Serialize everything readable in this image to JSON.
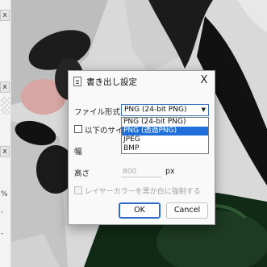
{
  "left_strip": {
    "close_glyph": "x",
    "percent_mark": "%",
    "minus_mark": "-"
  },
  "dialog": {
    "title": "書き出し設定",
    "close_glyph": "X",
    "format_label": "ファイル形式",
    "format_selected": "PNG (24-bit PNG)",
    "format_options": [
      {
        "label": "PNG (24-bit PNG)",
        "selected": false
      },
      {
        "label": "PNG (透過PNG)",
        "selected": true
      },
      {
        "label": "JPEG",
        "selected": false
      },
      {
        "label": "BMP",
        "selected": false
      }
    ],
    "size_checkbox_label": "以下のサイズ",
    "width_label": "幅",
    "height_label": "高さ",
    "height_value": "800",
    "height_unit": "px",
    "gray_checkbox_label": "レイヤーカラーを黒か白に強制する",
    "ok_label": "OK",
    "cancel_label": "Cancel"
  }
}
